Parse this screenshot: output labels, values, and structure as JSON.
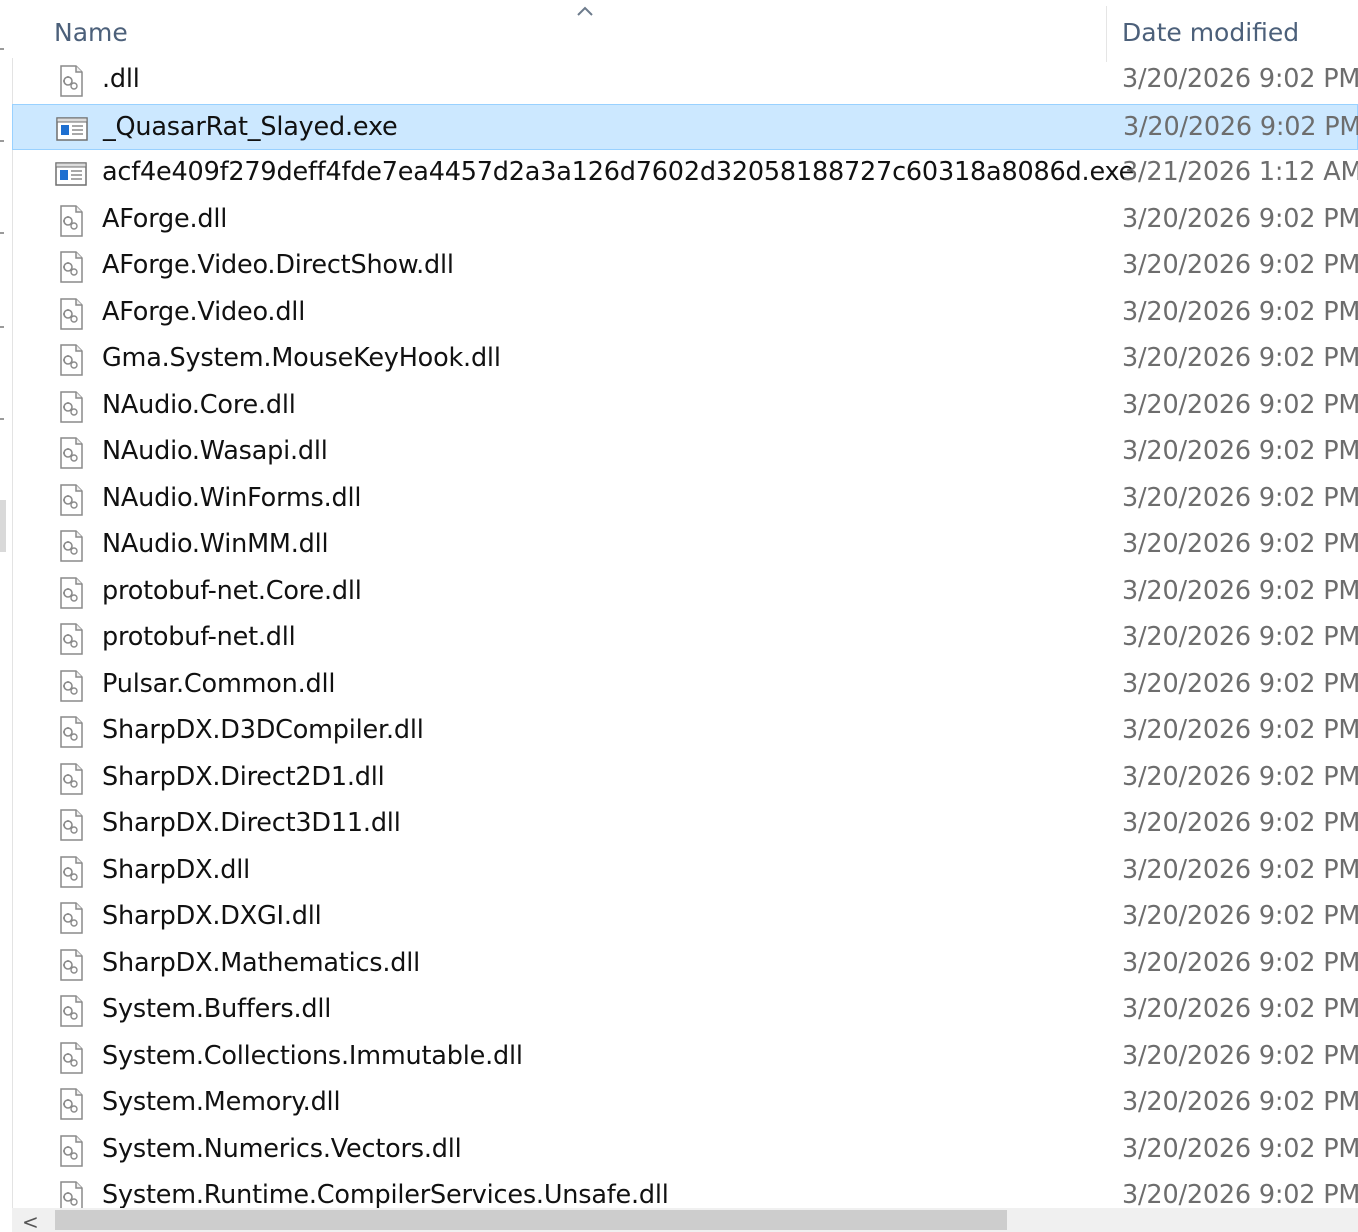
{
  "header": {
    "name_label": "Name",
    "date_label": "Date modified",
    "sort_icon": "chevron-up-icon"
  },
  "files": [
    {
      "name": ".dll",
      "date": "3/20/2026 9:02 PM",
      "type": "dll",
      "selected": false
    },
    {
      "name": "_QuasarRat_Slayed.exe",
      "date": "3/20/2026 9:02 PM",
      "type": "exe",
      "selected": true
    },
    {
      "name": "acf4e409f279deff4fde7ea4457d2a3a126d7602d32058188727c60318a8086d.exe",
      "date": "3/21/2026 1:12 AM",
      "type": "exe",
      "selected": false
    },
    {
      "name": "AForge.dll",
      "date": "3/20/2026 9:02 PM",
      "type": "dll",
      "selected": false
    },
    {
      "name": "AForge.Video.DirectShow.dll",
      "date": "3/20/2026 9:02 PM",
      "type": "dll",
      "selected": false
    },
    {
      "name": "AForge.Video.dll",
      "date": "3/20/2026 9:02 PM",
      "type": "dll",
      "selected": false
    },
    {
      "name": "Gma.System.MouseKeyHook.dll",
      "date": "3/20/2026 9:02 PM",
      "type": "dll",
      "selected": false
    },
    {
      "name": "NAudio.Core.dll",
      "date": "3/20/2026 9:02 PM",
      "type": "dll",
      "selected": false
    },
    {
      "name": "NAudio.Wasapi.dll",
      "date": "3/20/2026 9:02 PM",
      "type": "dll",
      "selected": false
    },
    {
      "name": "NAudio.WinForms.dll",
      "date": "3/20/2026 9:02 PM",
      "type": "dll",
      "selected": false
    },
    {
      "name": "NAudio.WinMM.dll",
      "date": "3/20/2026 9:02 PM",
      "type": "dll",
      "selected": false
    },
    {
      "name": "protobuf-net.Core.dll",
      "date": "3/20/2026 9:02 PM",
      "type": "dll",
      "selected": false
    },
    {
      "name": "protobuf-net.dll",
      "date": "3/20/2026 9:02 PM",
      "type": "dll",
      "selected": false
    },
    {
      "name": "Pulsar.Common.dll",
      "date": "3/20/2026 9:02 PM",
      "type": "dll",
      "selected": false
    },
    {
      "name": "SharpDX.D3DCompiler.dll",
      "date": "3/20/2026 9:02 PM",
      "type": "dll",
      "selected": false
    },
    {
      "name": "SharpDX.Direct2D1.dll",
      "date": "3/20/2026 9:02 PM",
      "type": "dll",
      "selected": false
    },
    {
      "name": "SharpDX.Direct3D11.dll",
      "date": "3/20/2026 9:02 PM",
      "type": "dll",
      "selected": false
    },
    {
      "name": "SharpDX.dll",
      "date": "3/20/2026 9:02 PM",
      "type": "dll",
      "selected": false
    },
    {
      "name": "SharpDX.DXGI.dll",
      "date": "3/20/2026 9:02 PM",
      "type": "dll",
      "selected": false
    },
    {
      "name": "SharpDX.Mathematics.dll",
      "date": "3/20/2026 9:02 PM",
      "type": "dll",
      "selected": false
    },
    {
      "name": "System.Buffers.dll",
      "date": "3/20/2026 9:02 PM",
      "type": "dll",
      "selected": false
    },
    {
      "name": "System.Collections.Immutable.dll",
      "date": "3/20/2026 9:02 PM",
      "type": "dll",
      "selected": false
    },
    {
      "name": "System.Memory.dll",
      "date": "3/20/2026 9:02 PM",
      "type": "dll",
      "selected": false
    },
    {
      "name": "System.Numerics.Vectors.dll",
      "date": "3/20/2026 9:02 PM",
      "type": "dll",
      "selected": false
    },
    {
      "name": "System.Runtime.CompilerServices.Unsafe.dll",
      "date": "3/20/2026 9:02 PM",
      "type": "dll",
      "selected": false
    }
  ],
  "scrollbar": {
    "left_arrow": "<",
    "left_arrow_icon": "chevron-left-icon"
  },
  "colors": {
    "selection_bg": "#cce8ff",
    "selection_border": "#99d1ff",
    "header_text": "#4c607a",
    "date_text": "#6d6d6d"
  }
}
